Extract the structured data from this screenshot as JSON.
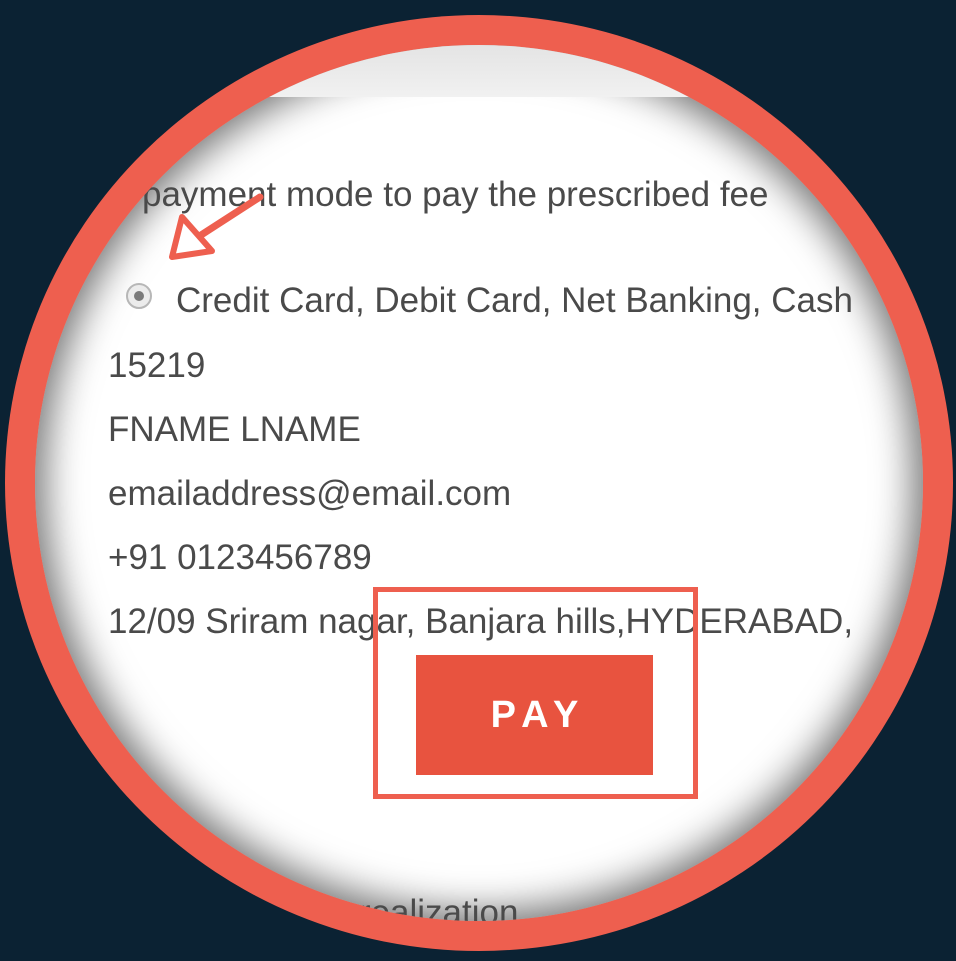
{
  "instruction_text": "payment mode to pay the prescribed fee",
  "payment_option": {
    "label": "Credit Card, Debit Card, Net Banking, Cash",
    "selected": true
  },
  "details": {
    "id": "15219",
    "name": "FNAME LNAME",
    "email": "emailaddress@email.com",
    "phone": "+91 0123456789",
    "address": "12/09 Sriram nagar, Banjara hills,HYDERABAD,"
  },
  "pay_button_label": "PAY",
  "footer_text": "to realization.",
  "colors": {
    "background": "#0b2233",
    "accent": "#ee5f4f",
    "button": "#e8533f",
    "text": "#4a4a4a"
  },
  "icons": {
    "annotation_arrow": "arrow-down-left-icon",
    "radio": "radio-selected-icon"
  }
}
